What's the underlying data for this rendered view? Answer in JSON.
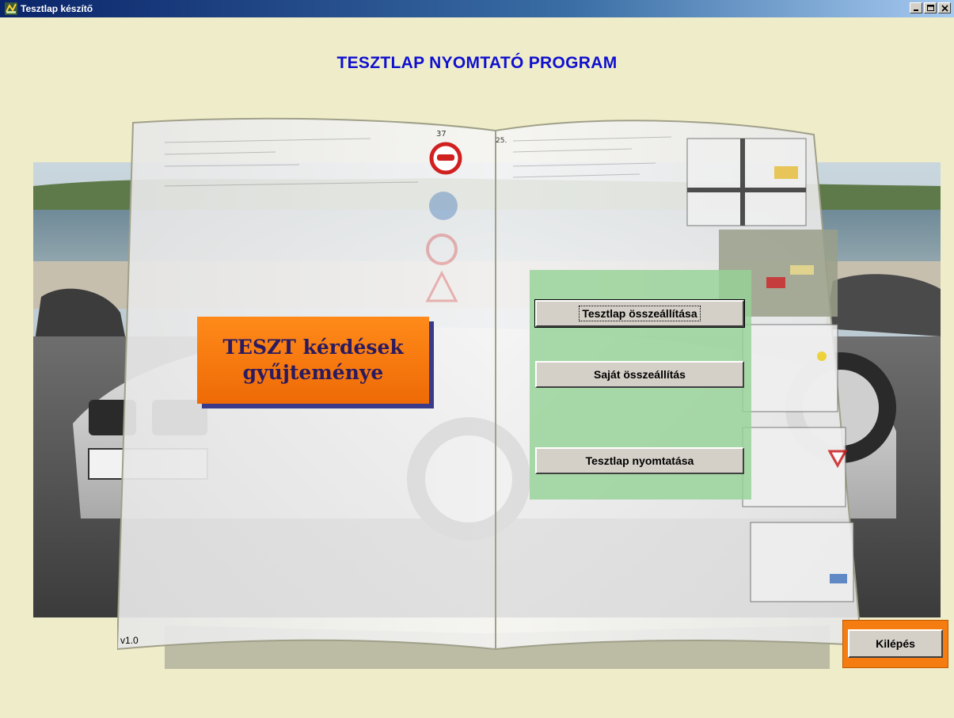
{
  "window": {
    "title": "Tesztlap készítő",
    "icon": "app-icon",
    "controls": [
      "minimize-icon",
      "maximize-icon",
      "close-icon"
    ]
  },
  "heading": "TESZTLAP NYOMTATÓ PROGRAM",
  "collection_sign": "TESZT kérdések\ngyűjteménye",
  "menu": {
    "compose_label": "Tesztlap összeállítása",
    "own_label": "Saját összeállítás",
    "print_label": "Tesztlap nyomtatása"
  },
  "version": "v1.0",
  "exit_label": "Kilépés",
  "colors": {
    "background": "#efedc9",
    "heading": "#1010d0",
    "accent_orange": "#f47c10",
    "panel_green": "#96d296",
    "button_face": "#d4d0c8"
  }
}
